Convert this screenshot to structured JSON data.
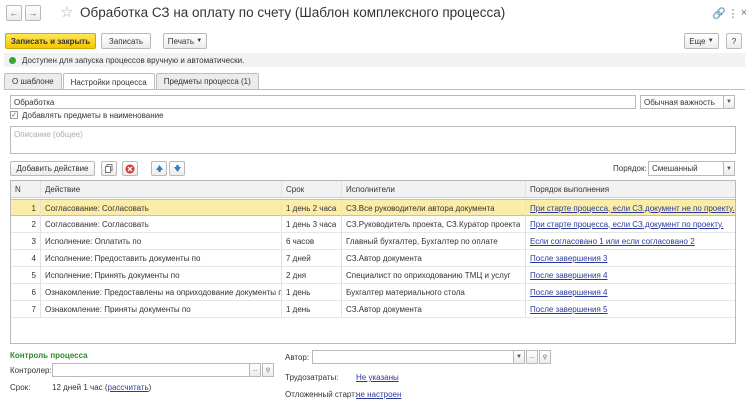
{
  "window": {
    "title": "Обработка СЗ на оплату по счету (Шаблон комплексного процесса)"
  },
  "toolbar": {
    "save_close": "Записать и закрыть",
    "save": "Записать",
    "print": "Печать",
    "more": "Еще",
    "help": "?"
  },
  "notice": "Доступен для запуска процессов вручную и автоматически.",
  "tabs": [
    "О шаблоне",
    "Настройки процесса",
    "Предметы процесса (1)"
  ],
  "form": {
    "name_value": "Обработка",
    "importance_value": "Обычная важность",
    "add_subjects_label": "Добавлять предметы в наименование",
    "description_placeholder": "Описание (общее)",
    "add_action": "Добавить действие",
    "order_label": "Порядок:",
    "order_value": "Смешанный"
  },
  "grid": {
    "columns": [
      "N",
      "Действие",
      "Срок",
      "Исполнители",
      "Порядок выполнения"
    ],
    "rows": [
      {
        "n": "1",
        "action": "Согласование: Согласовать",
        "term": "1 день 2 часа",
        "executors": "СЗ.Все руководители автора документа",
        "order": "При старте процесса, если СЗ.документ не по проекту."
      },
      {
        "n": "2",
        "action": "Согласование: Согласовать",
        "term": "1 день 3 часа",
        "executors": "СЗ.Руководитель проекта, СЗ.Куратор проекта",
        "order": "При старте процесса, если СЗ.документ по проекту."
      },
      {
        "n": "3",
        "action": "Исполнение: Оплатить по",
        "term": "6 часов",
        "executors": "Главный бухгалтер, Бухгалтер по оплате",
        "order": "Если согласовано 1 или если согласовано 2"
      },
      {
        "n": "4",
        "action": "Исполнение: Предоставить документы по",
        "term": "7 дней",
        "executors": "СЗ.Автор документа",
        "order": "После завершения 3"
      },
      {
        "n": "5",
        "action": "Исполнение: Принять документы по",
        "term": "2 дня",
        "executors": "Специалист по оприходованию ТМЦ и услуг",
        "order": "После завершения 4"
      },
      {
        "n": "6",
        "action": "Ознакомление: Предоставлены на оприходование документы по",
        "term": "1 день",
        "executors": "Бухгалтер материального стола",
        "order": "После завершения 4"
      },
      {
        "n": "7",
        "action": "Ознакомление: Приняты документы по",
        "term": "1 день",
        "executors": "СЗ.Автор документа",
        "order": "После завершения 5"
      }
    ]
  },
  "control": {
    "section_title": "Контроль процесса",
    "controller_label": "Контролер:",
    "term_label": "Срок:",
    "term_value": "12 дней 1 час (",
    "term_link": "рассчитать",
    "term_close": ")",
    "author_label": "Автор:",
    "labor_label": "Трудозатраты:",
    "labor_value": "Не указаны",
    "delayed_label": "Отложенный старт:",
    "delayed_value": "не настроен"
  },
  "colors": {
    "primary_button": "#f5c600",
    "selected_row": "#fbeca8",
    "link": "#2a3a9a",
    "section_green": "#2e8b2e"
  }
}
